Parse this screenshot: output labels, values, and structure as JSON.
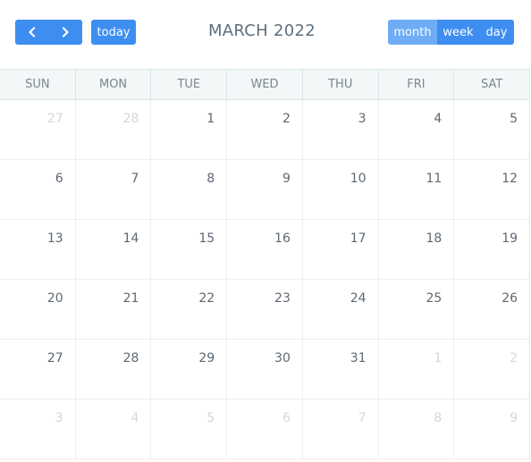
{
  "toolbar": {
    "prev_icon": "chevron-left-icon",
    "next_icon": "chevron-right-icon",
    "today_label": "today",
    "title": "MARCH 2022",
    "views": [
      {
        "label": "month",
        "active": true
      },
      {
        "label": "week",
        "active": false
      },
      {
        "label": "day",
        "active": false
      }
    ]
  },
  "colors": {
    "accent": "#3d8ef0",
    "accent_active": "#6eadf5",
    "header_bg": "#f3f7f8"
  },
  "weekdays": [
    "SUN",
    "MON",
    "TUE",
    "WED",
    "THU",
    "FRI",
    "SAT"
  ],
  "weeks": [
    [
      {
        "d": "27",
        "o": true
      },
      {
        "d": "28",
        "o": true
      },
      {
        "d": "1"
      },
      {
        "d": "2"
      },
      {
        "d": "3"
      },
      {
        "d": "4"
      },
      {
        "d": "5"
      }
    ],
    [
      {
        "d": "6"
      },
      {
        "d": "7"
      },
      {
        "d": "8"
      },
      {
        "d": "9"
      },
      {
        "d": "10"
      },
      {
        "d": "11"
      },
      {
        "d": "12"
      }
    ],
    [
      {
        "d": "13"
      },
      {
        "d": "14"
      },
      {
        "d": "15"
      },
      {
        "d": "16"
      },
      {
        "d": "17"
      },
      {
        "d": "18"
      },
      {
        "d": "19"
      }
    ],
    [
      {
        "d": "20"
      },
      {
        "d": "21"
      },
      {
        "d": "22"
      },
      {
        "d": "23"
      },
      {
        "d": "24"
      },
      {
        "d": "25"
      },
      {
        "d": "26"
      }
    ],
    [
      {
        "d": "27"
      },
      {
        "d": "28"
      },
      {
        "d": "29"
      },
      {
        "d": "30"
      },
      {
        "d": "31"
      },
      {
        "d": "1",
        "o": true
      },
      {
        "d": "2",
        "o": true
      }
    ],
    [
      {
        "d": "3",
        "o": true
      },
      {
        "d": "4",
        "o": true
      },
      {
        "d": "5",
        "o": true
      },
      {
        "d": "6",
        "o": true
      },
      {
        "d": "7",
        "o": true
      },
      {
        "d": "8",
        "o": true
      },
      {
        "d": "9",
        "o": true
      }
    ]
  ]
}
